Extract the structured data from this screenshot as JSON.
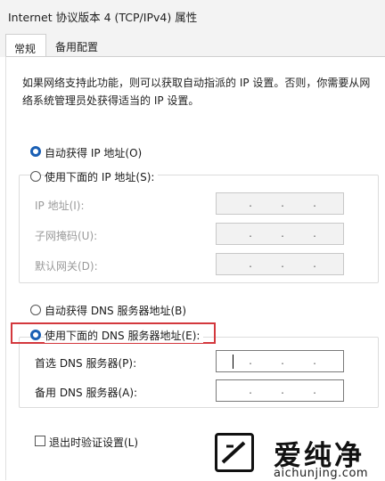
{
  "window": {
    "title": "Internet 协议版本 4 (TCP/IPv4) 属性"
  },
  "tabs": [
    {
      "label": "常规",
      "active": true
    },
    {
      "label": "备用配置",
      "active": false
    }
  ],
  "description": "如果网络支持此功能，则可以获取自动指派的 IP 设置。否则，你需要从网络系统管理员处获得适当的 IP 设置。",
  "ip_section": {
    "auto_label": "自动获得 IP 地址(O)",
    "auto_selected": true,
    "manual_label": "使用下面的 IP 地址(S):",
    "manual_selected": false,
    "fields": [
      {
        "label": "IP 地址(I):",
        "dots": ".    .    ."
      },
      {
        "label": "子网掩码(U):",
        "dots": ".    .    ."
      },
      {
        "label": "默认网关(D):",
        "dots": ".    .    ."
      }
    ]
  },
  "dns_section": {
    "auto_label": "自动获得 DNS 服务器地址(B)",
    "auto_selected": false,
    "manual_label": "使用下面的 DNS 服务器地址(E):",
    "manual_selected": true,
    "fields": [
      {
        "label": "首选 DNS 服务器(P):",
        "dots": ".    .    ."
      },
      {
        "label": "备用 DNS 服务器(A):",
        "dots": ".    .    ."
      }
    ]
  },
  "validate": {
    "label": "退出时验证设置(L)",
    "checked": false
  },
  "watermark": {
    "brand": "爱纯净",
    "site": "aichunjing.com"
  },
  "colors": {
    "accent": "#1a5fb4",
    "highlight": "#d3383d"
  }
}
